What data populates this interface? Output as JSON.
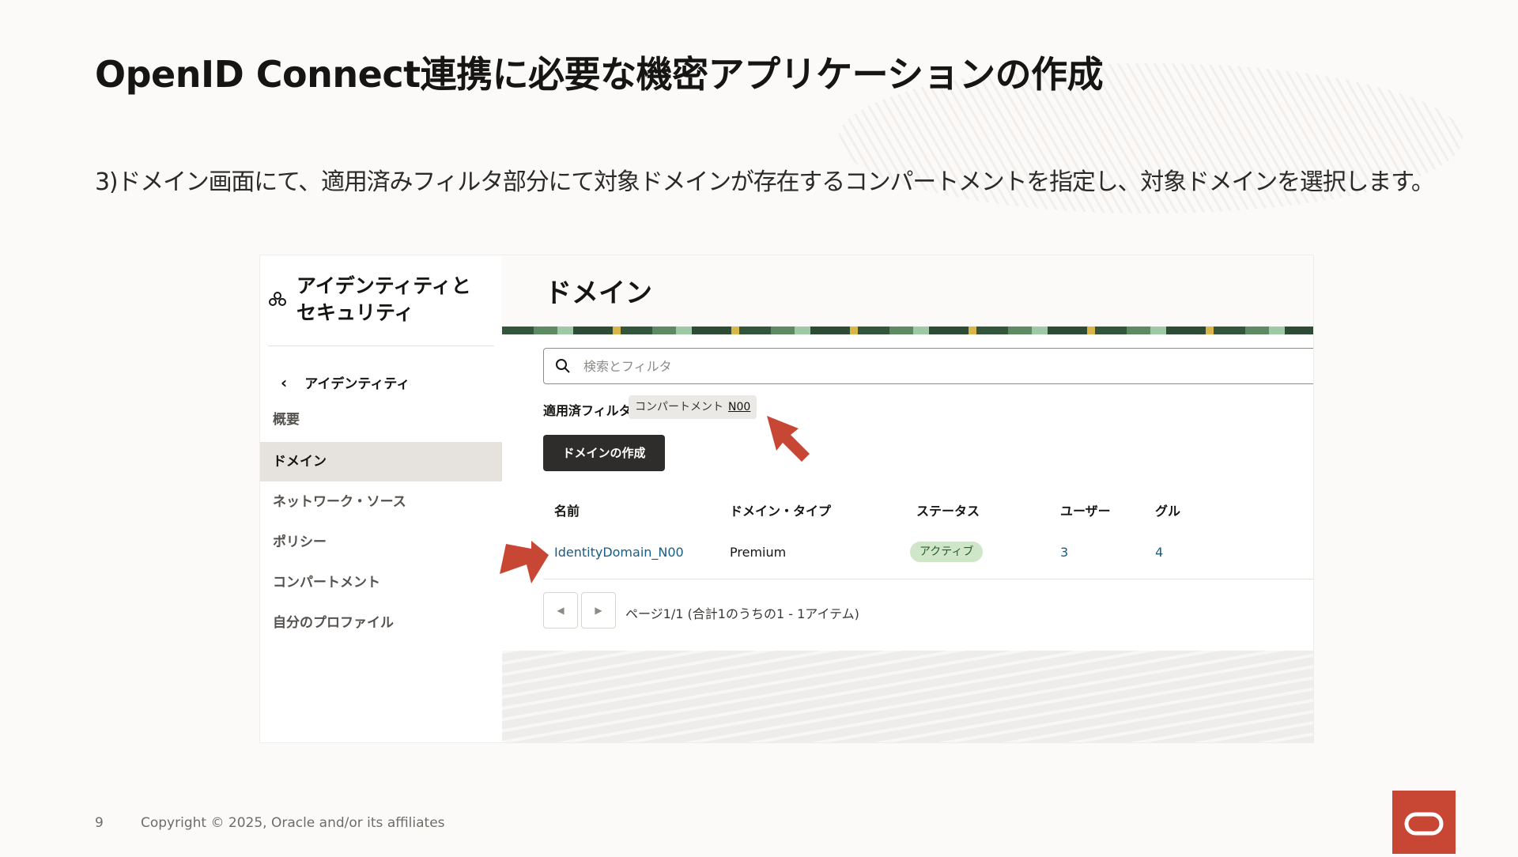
{
  "slide": {
    "title": "OpenID Connect連携に必要な機密アプリケーションの作成",
    "subtitle": "3)ドメイン画面にて、適用済みフィルタ部分にて対象ドメインが存在するコンパートメントを指定し、対象ドメインを選択します。",
    "page_number": "9",
    "copyright": "Copyright © 2025, Oracle and/or its affiliates"
  },
  "sidebar": {
    "title": "アイデンティティと セキュリティ",
    "back_label": "アイデンティティ",
    "items": [
      {
        "label": "概要",
        "active": false
      },
      {
        "label": "ドメイン",
        "active": true
      },
      {
        "label": "ネットワーク・ソース",
        "active": false
      },
      {
        "label": "ポリシー",
        "active": false
      },
      {
        "label": "コンパートメント",
        "active": false
      },
      {
        "label": "自分のプロファイル",
        "active": false
      }
    ]
  },
  "main": {
    "title": "ドメイン",
    "search_placeholder": "検索とフィルタ",
    "applied_filters_label": "適用済フィルタ",
    "filter_chip": {
      "key": "コンパートメント",
      "value": "N00"
    },
    "create_button": "ドメインの作成",
    "table": {
      "headers": [
        "名前",
        "ドメイン・タイプ",
        "ステータス",
        "ユーザー",
        "グル"
      ],
      "rows": [
        {
          "name": "IdentityDomain_N00",
          "type": "Premium",
          "status": "アクティブ",
          "users": "3",
          "groups": "4"
        }
      ]
    },
    "pagination": "ページ1/1 (合計1のうちの1 - 1アイテム)"
  },
  "icons": {
    "sidebar": "identity-security-icon",
    "back": "chevron-left-icon",
    "search": "search-icon",
    "prev": "caret-left-icon",
    "next": "caret-right-icon",
    "logo": "oracle-logo"
  },
  "colors": {
    "accent_red": "#c74634",
    "link_blue": "#1a5c84",
    "status_green_bg": "#cfe7c8"
  }
}
